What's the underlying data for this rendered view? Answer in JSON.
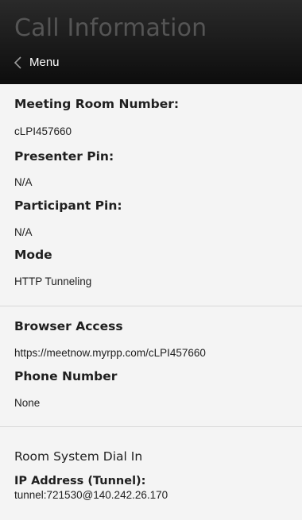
{
  "header": {
    "title": "Call Information",
    "back_label": "Menu"
  },
  "call_info": {
    "meeting_room_label": "Meeting Room Number:",
    "meeting_room_value": "cLPI457660",
    "presenter_pin_label": "Presenter Pin:",
    "presenter_pin_value": "N/A",
    "participant_pin_label": "Participant Pin:",
    "participant_pin_value": "N/A",
    "mode_label": "Mode",
    "mode_value": "HTTP Tunneling"
  },
  "access": {
    "browser_access_label": "Browser Access",
    "browser_access_value": "https://meetnow.myrpp.com/cLPI457660",
    "phone_number_label": "Phone Number",
    "phone_number_value": "None"
  },
  "room_system": {
    "title": "Room System Dial In",
    "ip_label": "IP Address (Tunnel):",
    "ip_value": "tunnel:721530@140.242.26.170"
  }
}
